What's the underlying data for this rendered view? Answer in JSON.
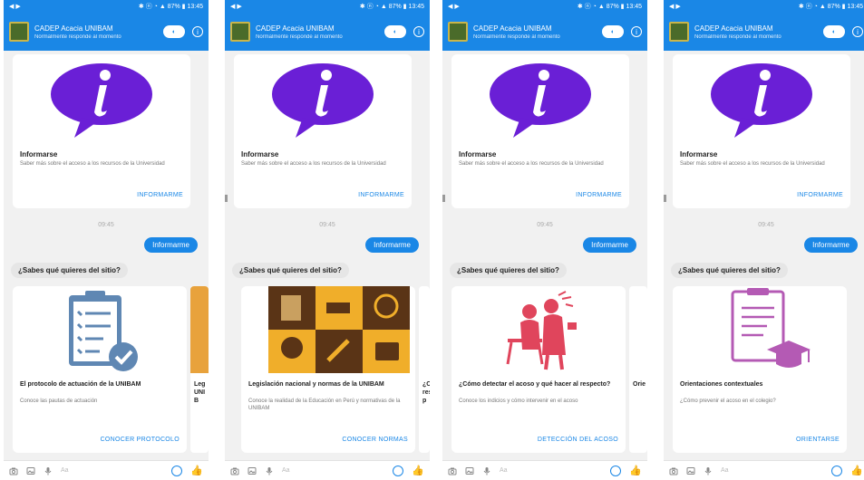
{
  "statusbar": {
    "left": "◀ ▶",
    "right": "✱ ⓝ ◔ ▲ 87% ▮ 13:45"
  },
  "header": {
    "title": "CADEP Acacia UNIBAM",
    "subtitle": "Normalmente responde al momento",
    "switch_label": "◐"
  },
  "card1": {
    "title": "Informarse",
    "desc": "Saber más sobre el acceso a los recursos de la Universidad",
    "link": "INFORMARME"
  },
  "time": "09:45",
  "out_message": "Informarme",
  "question": "¿Sabes qué quieres del sitio?",
  "carousel": [
    {
      "title": "El protocolo de actuación de la UNIBAM",
      "desc": "Conoce las pautas de actuación",
      "link": "CONOCER PROTOCOLO"
    },
    {
      "title": "Legislación nacional y normas de la UNIBAM",
      "desc": "Conoce la realidad de la Educación en Perú y normativas de la UNIBAM",
      "link": "CONOCER NORMAS"
    },
    {
      "title": "¿Cómo detectar el acoso y qué hacer al respecto?",
      "desc": "Conoce los indicios y cómo intervenir en el acoso",
      "link": "DETECCIÓN DEL ACOSO"
    },
    {
      "title": "Orientaciones contextuales",
      "desc": "¿Cómo prevenir el acoso en el colegio?",
      "link": "ORIENTARSE"
    }
  ],
  "peek_labels": [
    "Leg UNIB",
    "¿Có resp",
    "Orie"
  ],
  "composer": {
    "placeholder": "Aa"
  },
  "icons": {
    "camera": "camera-icon",
    "gallery": "gallery-icon",
    "mic": "mic-icon",
    "emoji": "emoji-icon",
    "like": "like-icon",
    "info": "info-icon"
  }
}
